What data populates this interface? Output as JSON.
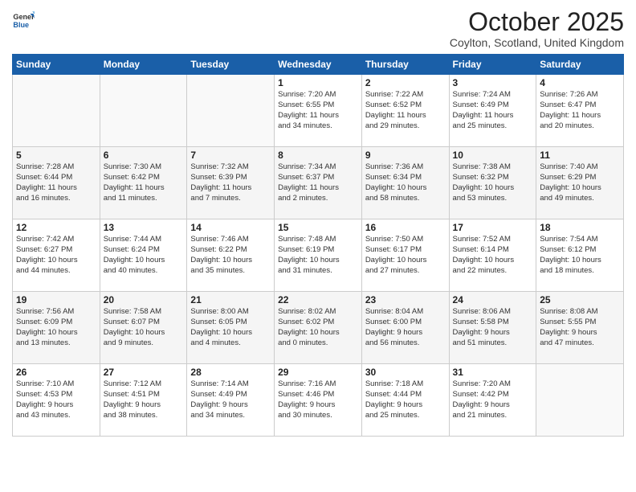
{
  "header": {
    "title": "October 2025",
    "location": "Coylton, Scotland, United Kingdom"
  },
  "calendar": {
    "headers": [
      "Sunday",
      "Monday",
      "Tuesday",
      "Wednesday",
      "Thursday",
      "Friday",
      "Saturday"
    ],
    "weeks": [
      [
        {
          "day": "",
          "info": ""
        },
        {
          "day": "",
          "info": ""
        },
        {
          "day": "",
          "info": ""
        },
        {
          "day": "1",
          "info": "Sunrise: 7:20 AM\nSunset: 6:55 PM\nDaylight: 11 hours\nand 34 minutes."
        },
        {
          "day": "2",
          "info": "Sunrise: 7:22 AM\nSunset: 6:52 PM\nDaylight: 11 hours\nand 29 minutes."
        },
        {
          "day": "3",
          "info": "Sunrise: 7:24 AM\nSunset: 6:49 PM\nDaylight: 11 hours\nand 25 minutes."
        },
        {
          "day": "4",
          "info": "Sunrise: 7:26 AM\nSunset: 6:47 PM\nDaylight: 11 hours\nand 20 minutes."
        }
      ],
      [
        {
          "day": "5",
          "info": "Sunrise: 7:28 AM\nSunset: 6:44 PM\nDaylight: 11 hours\nand 16 minutes."
        },
        {
          "day": "6",
          "info": "Sunrise: 7:30 AM\nSunset: 6:42 PM\nDaylight: 11 hours\nand 11 minutes."
        },
        {
          "day": "7",
          "info": "Sunrise: 7:32 AM\nSunset: 6:39 PM\nDaylight: 11 hours\nand 7 minutes."
        },
        {
          "day": "8",
          "info": "Sunrise: 7:34 AM\nSunset: 6:37 PM\nDaylight: 11 hours\nand 2 minutes."
        },
        {
          "day": "9",
          "info": "Sunrise: 7:36 AM\nSunset: 6:34 PM\nDaylight: 10 hours\nand 58 minutes."
        },
        {
          "day": "10",
          "info": "Sunrise: 7:38 AM\nSunset: 6:32 PM\nDaylight: 10 hours\nand 53 minutes."
        },
        {
          "day": "11",
          "info": "Sunrise: 7:40 AM\nSunset: 6:29 PM\nDaylight: 10 hours\nand 49 minutes."
        }
      ],
      [
        {
          "day": "12",
          "info": "Sunrise: 7:42 AM\nSunset: 6:27 PM\nDaylight: 10 hours\nand 44 minutes."
        },
        {
          "day": "13",
          "info": "Sunrise: 7:44 AM\nSunset: 6:24 PM\nDaylight: 10 hours\nand 40 minutes."
        },
        {
          "day": "14",
          "info": "Sunrise: 7:46 AM\nSunset: 6:22 PM\nDaylight: 10 hours\nand 35 minutes."
        },
        {
          "day": "15",
          "info": "Sunrise: 7:48 AM\nSunset: 6:19 PM\nDaylight: 10 hours\nand 31 minutes."
        },
        {
          "day": "16",
          "info": "Sunrise: 7:50 AM\nSunset: 6:17 PM\nDaylight: 10 hours\nand 27 minutes."
        },
        {
          "day": "17",
          "info": "Sunrise: 7:52 AM\nSunset: 6:14 PM\nDaylight: 10 hours\nand 22 minutes."
        },
        {
          "day": "18",
          "info": "Sunrise: 7:54 AM\nSunset: 6:12 PM\nDaylight: 10 hours\nand 18 minutes."
        }
      ],
      [
        {
          "day": "19",
          "info": "Sunrise: 7:56 AM\nSunset: 6:09 PM\nDaylight: 10 hours\nand 13 minutes."
        },
        {
          "day": "20",
          "info": "Sunrise: 7:58 AM\nSunset: 6:07 PM\nDaylight: 10 hours\nand 9 minutes."
        },
        {
          "day": "21",
          "info": "Sunrise: 8:00 AM\nSunset: 6:05 PM\nDaylight: 10 hours\nand 4 minutes."
        },
        {
          "day": "22",
          "info": "Sunrise: 8:02 AM\nSunset: 6:02 PM\nDaylight: 10 hours\nand 0 minutes."
        },
        {
          "day": "23",
          "info": "Sunrise: 8:04 AM\nSunset: 6:00 PM\nDaylight: 9 hours\nand 56 minutes."
        },
        {
          "day": "24",
          "info": "Sunrise: 8:06 AM\nSunset: 5:58 PM\nDaylight: 9 hours\nand 51 minutes."
        },
        {
          "day": "25",
          "info": "Sunrise: 8:08 AM\nSunset: 5:55 PM\nDaylight: 9 hours\nand 47 minutes."
        }
      ],
      [
        {
          "day": "26",
          "info": "Sunrise: 7:10 AM\nSunset: 4:53 PM\nDaylight: 9 hours\nand 43 minutes."
        },
        {
          "day": "27",
          "info": "Sunrise: 7:12 AM\nSunset: 4:51 PM\nDaylight: 9 hours\nand 38 minutes."
        },
        {
          "day": "28",
          "info": "Sunrise: 7:14 AM\nSunset: 4:49 PM\nDaylight: 9 hours\nand 34 minutes."
        },
        {
          "day": "29",
          "info": "Sunrise: 7:16 AM\nSunset: 4:46 PM\nDaylight: 9 hours\nand 30 minutes."
        },
        {
          "day": "30",
          "info": "Sunrise: 7:18 AM\nSunset: 4:44 PM\nDaylight: 9 hours\nand 25 minutes."
        },
        {
          "day": "31",
          "info": "Sunrise: 7:20 AM\nSunset: 4:42 PM\nDaylight: 9 hours\nand 21 minutes."
        },
        {
          "day": "",
          "info": ""
        }
      ]
    ]
  }
}
